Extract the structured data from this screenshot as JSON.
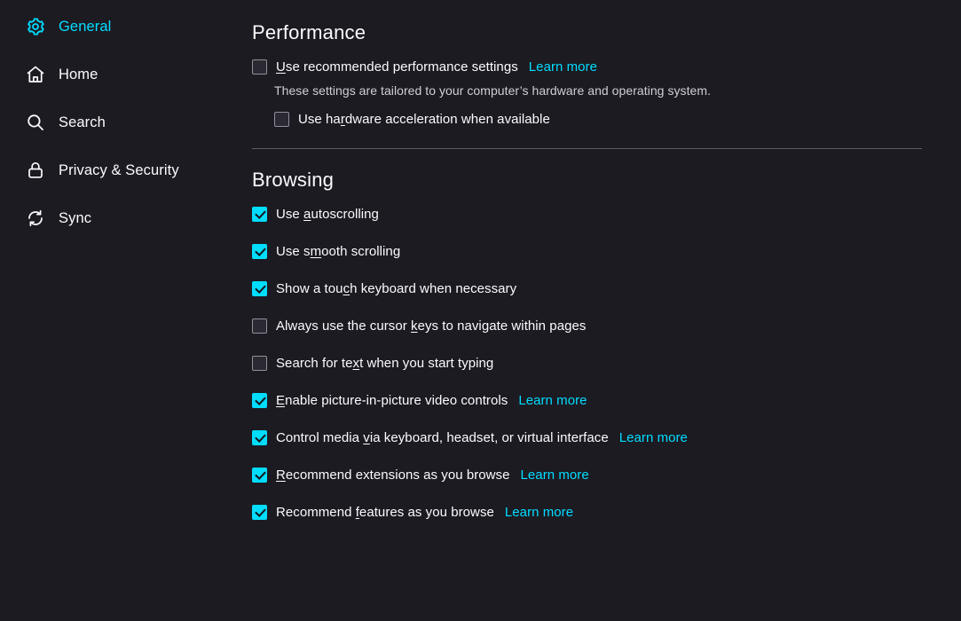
{
  "sidebar": {
    "items": [
      {
        "id": "general",
        "label": "General",
        "icon": "gear-icon",
        "selected": true
      },
      {
        "id": "home",
        "label": "Home",
        "icon": "home-icon",
        "selected": false
      },
      {
        "id": "search",
        "label": "Search",
        "icon": "search-icon",
        "selected": false
      },
      {
        "id": "privacy",
        "label": "Privacy & Security",
        "icon": "lock-icon",
        "selected": false
      },
      {
        "id": "sync",
        "label": "Sync",
        "icon": "sync-icon",
        "selected": false
      }
    ]
  },
  "main": {
    "performance": {
      "title": "Performance",
      "recommended": {
        "label_pre": "",
        "accesskey": "U",
        "label_post": "se recommended performance settings",
        "checked": false,
        "learn_more": "Learn more"
      },
      "description": "These settings are tailored to your computer’s hardware and operating system.",
      "hardware_accel": {
        "label_pre": "Use ha",
        "accesskey": "r",
        "label_post": "dware acceleration when available",
        "checked": false
      }
    },
    "browsing": {
      "title": "Browsing",
      "options": [
        {
          "label_pre": "Use ",
          "accesskey": "a",
          "label_post": "utoscrolling",
          "checked": true,
          "learn_more": ""
        },
        {
          "label_pre": "Use s",
          "accesskey": "m",
          "label_post": "ooth scrolling",
          "checked": true,
          "learn_more": ""
        },
        {
          "label_pre": "Show a tou",
          "accesskey": "c",
          "label_post": "h keyboard when necessary",
          "checked": true,
          "learn_more": ""
        },
        {
          "label_pre": "Always use the cursor ",
          "accesskey": "k",
          "label_post": "eys to navigate within pages",
          "checked": false,
          "learn_more": ""
        },
        {
          "label_pre": "Search for te",
          "accesskey": "x",
          "label_post": "t when you start typing",
          "checked": false,
          "learn_more": ""
        },
        {
          "label_pre": "",
          "accesskey": "E",
          "label_post": "nable picture-in-picture video controls",
          "checked": true,
          "learn_more": "Learn more"
        },
        {
          "label_pre": "Control media ",
          "accesskey": "v",
          "label_post": "ia keyboard, headset, or virtual interface",
          "checked": true,
          "learn_more": "Learn more"
        },
        {
          "label_pre": "",
          "accesskey": "R",
          "label_post": "ecommend extensions as you browse",
          "checked": true,
          "learn_more": "Learn more"
        },
        {
          "label_pre": "Recommend ",
          "accesskey": "f",
          "label_post": "eatures as you browse",
          "checked": true,
          "learn_more": "Learn more"
        }
      ]
    }
  },
  "colors": {
    "background": "#1c1b22",
    "accent": "#00ddff",
    "text": "#fbfbfe",
    "muted_text": "#cfcfd8",
    "divider": "#5b5b66",
    "checkbox_border": "#8f8f9d",
    "checkbox_bg": "#2b2a33"
  }
}
